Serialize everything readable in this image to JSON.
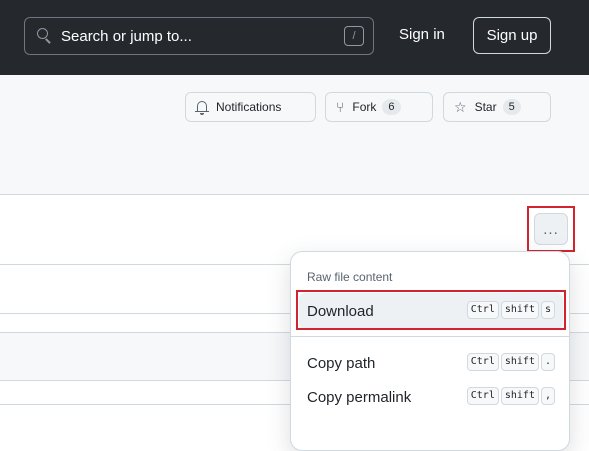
{
  "header": {
    "search_placeholder": "Search or jump to...",
    "search_shortcut": "/",
    "sign_in": "Sign in",
    "sign_up": "Sign up"
  },
  "repo_actions": {
    "notifications_label": "Notifications",
    "fork_label": "Fork",
    "fork_count": "6",
    "star_label": "Star",
    "star_count": "5"
  },
  "file_toolbar": {
    "more_icon": "kebab-horizontal-icon",
    "more_label": "..."
  },
  "menu": {
    "heading": "Raw file content",
    "items": [
      {
        "label": "Download",
        "keys": [
          "Ctrl",
          "shift",
          "s"
        ]
      },
      {
        "label": "Copy path",
        "keys": [
          "Ctrl",
          "shift",
          "."
        ]
      },
      {
        "label": "Copy permalink",
        "keys": [
          "Ctrl",
          "shift",
          ","
        ]
      }
    ]
  },
  "colors": {
    "header_bg": "#25292e",
    "highlight": "#d1242f"
  }
}
